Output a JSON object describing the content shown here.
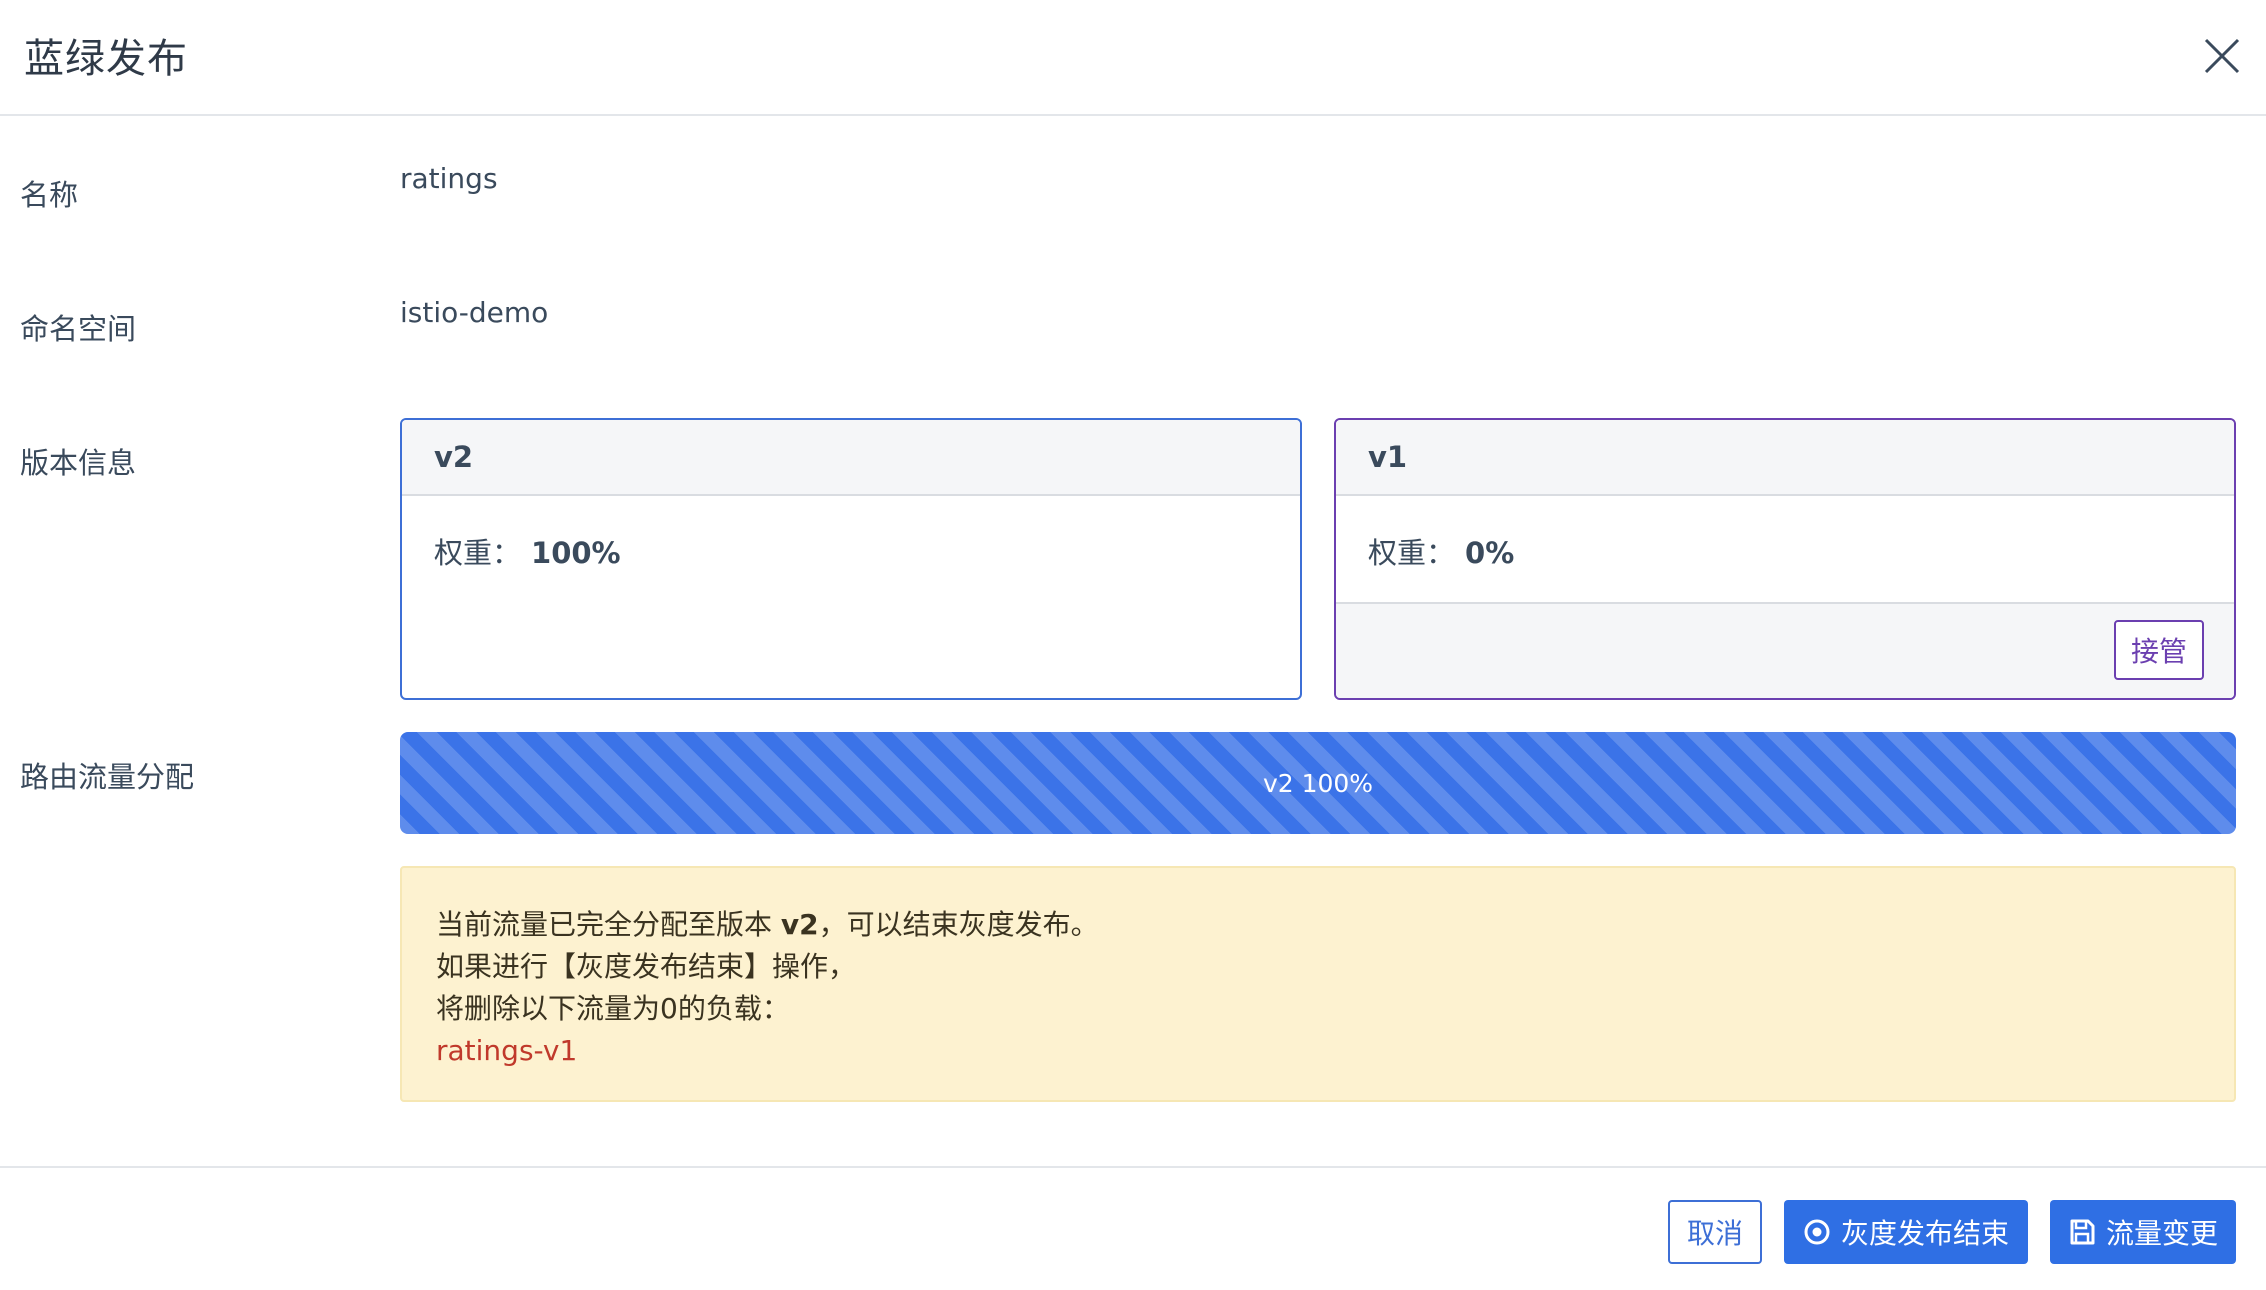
{
  "dialog": {
    "title": "蓝绿发布",
    "close_icon": "close-icon"
  },
  "fields": {
    "name": {
      "label": "名称",
      "value": "ratings"
    },
    "namespace": {
      "label": "命名空间",
      "value": "istio-demo"
    },
    "version_info": {
      "label": "版本信息"
    },
    "route_traffic": {
      "label": "路由流量分配"
    }
  },
  "versions": {
    "v2": {
      "name": "v2",
      "weight_label": "权重：",
      "weight_value": "100%",
      "border_color": "#3d6fd6"
    },
    "v1": {
      "name": "v1",
      "weight_label": "权重：",
      "weight_value": "0%",
      "border_color": "#6b3fb0",
      "takeover_label": "接管"
    }
  },
  "traffic": {
    "bar_label": "v2 100%",
    "v2_percent": 100,
    "bar_color": "#3b73e8"
  },
  "notice": {
    "line1_prefix": "当前流量已完全分配至版本 ",
    "line1_version": "v2",
    "line1_suffix": "，可以结束灰度发布。",
    "line2": "如果进行【灰度发布结束】操作，",
    "line3": "将删除以下流量为0的负载：",
    "workload": "ratings-v1",
    "background": "#fdf2d0"
  },
  "footer": {
    "cancel_label": "取消",
    "end_label": "灰度发布结束",
    "end_icon": "target-circle-icon",
    "change_label": "流量变更",
    "change_icon": "save-icon",
    "primary_color": "#2f6fe4"
  }
}
